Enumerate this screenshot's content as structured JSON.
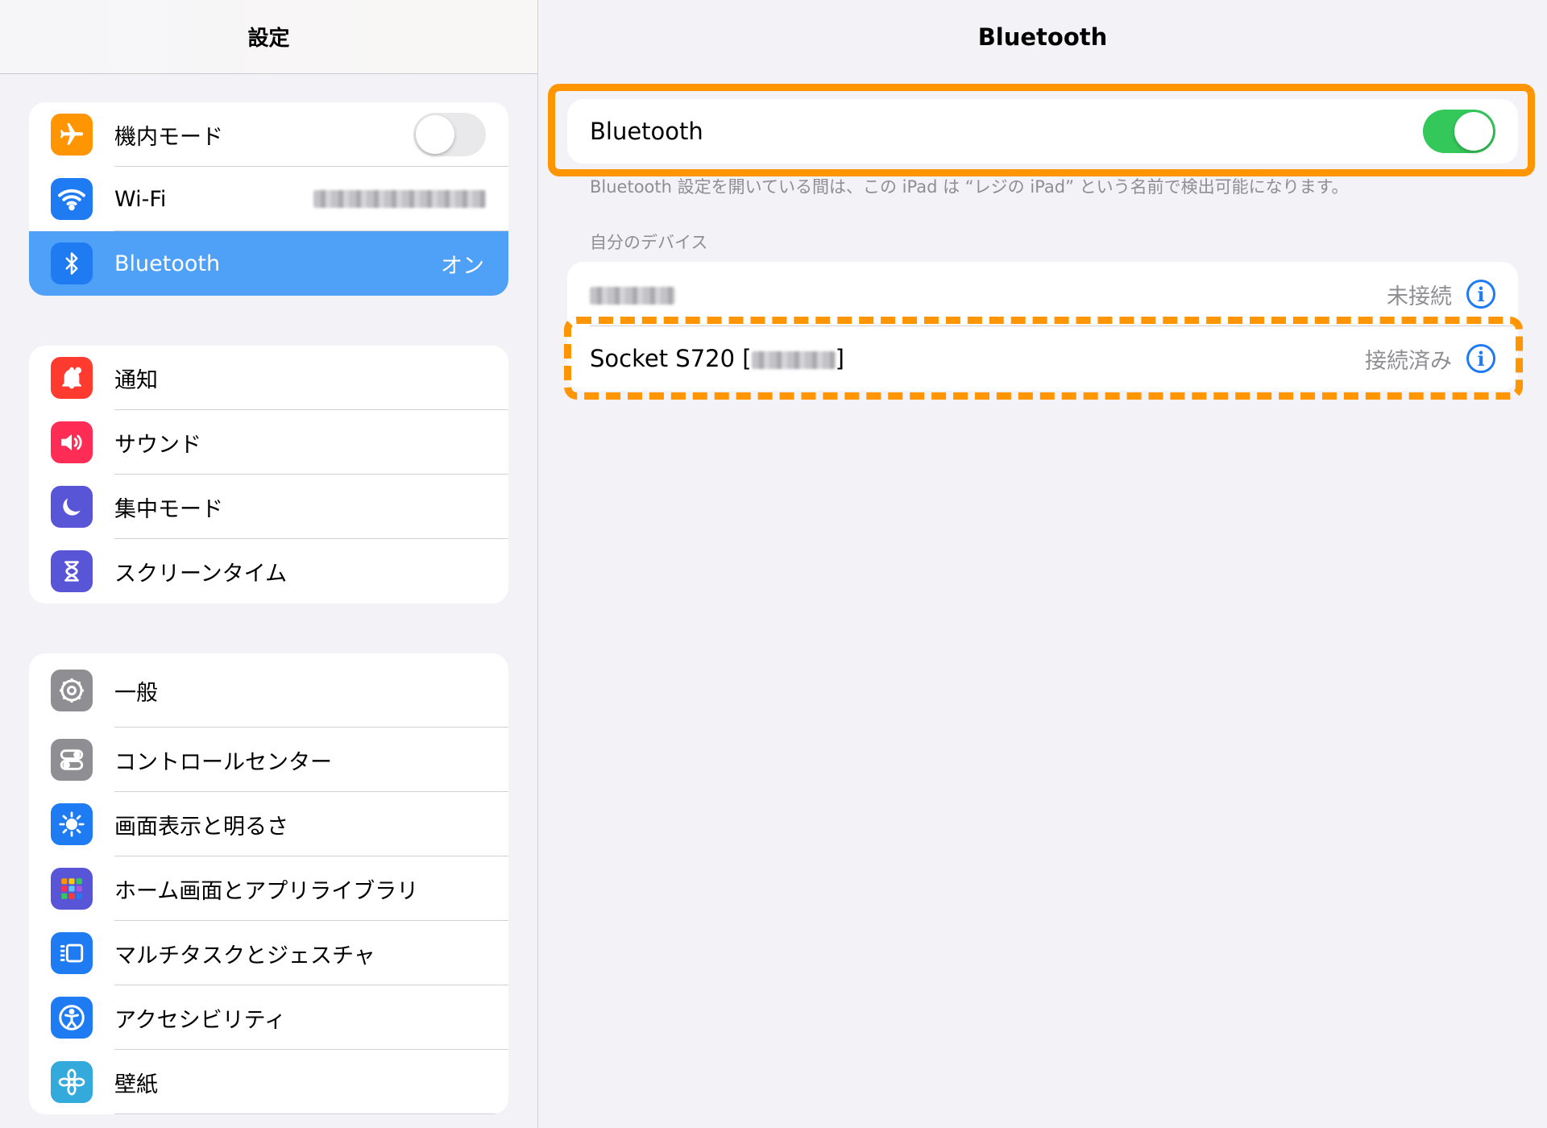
{
  "sidebar": {
    "title": "設定",
    "groups": [
      [
        {
          "label": "機内モード",
          "icon": "airplane-icon",
          "color": "#ff9500",
          "accessory": "toggle-off"
        },
        {
          "label": "Wi-Fi",
          "icon": "wifi-icon",
          "color": "#1e7bf2",
          "accessory": "blurred"
        },
        {
          "label": "Bluetooth",
          "icon": "bluetooth-icon",
          "color": "#1e7bf2",
          "value": "オン",
          "selected": true
        }
      ],
      [
        {
          "label": "通知",
          "icon": "bell-icon",
          "color": "#ff3b30"
        },
        {
          "label": "サウンド",
          "icon": "speaker-icon",
          "color": "#ff2d55"
        },
        {
          "label": "集中モード",
          "icon": "moon-icon",
          "color": "#5856d6"
        },
        {
          "label": "スクリーンタイム",
          "icon": "hourglass-icon",
          "color": "#5856d6"
        }
      ],
      [
        {
          "label": "一般",
          "icon": "gear-icon",
          "color": "#8e8e93"
        },
        {
          "label": "コントロールセンター",
          "icon": "switches-icon",
          "color": "#8e8e93"
        },
        {
          "label": "画面表示と明るさ",
          "icon": "sun-icon",
          "color": "#1e7bf2"
        },
        {
          "label": "ホーム画面とアプリライブラリ",
          "icon": "grid-icon",
          "color": "#5856d6"
        },
        {
          "label": "マルチタスクとジェスチャ",
          "icon": "multitask-icon",
          "color": "#1e7bf2"
        },
        {
          "label": "アクセシビリティ",
          "icon": "accessibility-icon",
          "color": "#1e7bf2"
        },
        {
          "label": "壁紙",
          "icon": "flower-icon",
          "color": "#34aadc"
        }
      ]
    ]
  },
  "main": {
    "title": "Bluetooth",
    "bluetooth_label": "Bluetooth",
    "bluetooth_on": true,
    "footnote": "Bluetooth 設定を開いている間は、この iPad は “レジの iPad” という名前で検出可能になります。",
    "my_devices_header": "自分のデバイス",
    "devices": [
      {
        "name": "",
        "status": "未接続"
      },
      {
        "name": "Socket S720 [",
        "name_suffix": "]",
        "status": "接続済み"
      }
    ]
  },
  "colors": {
    "accent": "#ff9500",
    "selected_row": "#4fa0f7",
    "toggle_on": "#34c759",
    "info": "#1e7bf2"
  }
}
